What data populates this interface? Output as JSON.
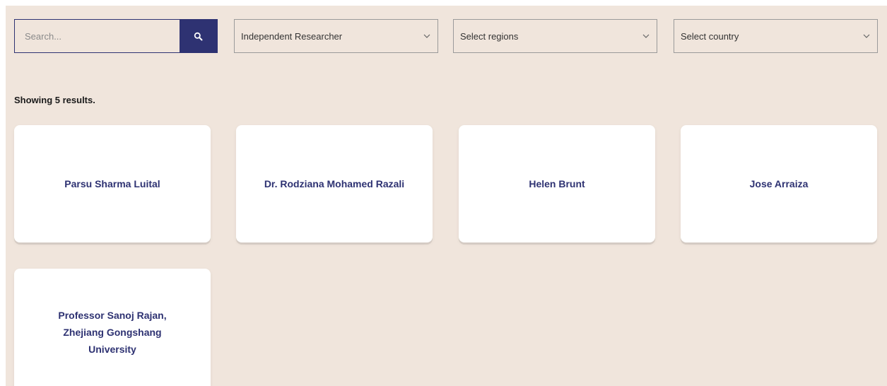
{
  "search": {
    "placeholder": "Search..."
  },
  "filters": {
    "type": {
      "selected": "Independent Researcher"
    },
    "regions": {
      "selected": "Select regions"
    },
    "country": {
      "selected": "Select country"
    }
  },
  "results": {
    "summary": "Showing 5 results.",
    "items": [
      {
        "name": "Parsu Sharma Luital"
      },
      {
        "name": "Dr. Rodziana Mohamed Razali"
      },
      {
        "name": "Helen Brunt"
      },
      {
        "name": "Jose Arraiza"
      },
      {
        "name": "Professor Sanoj Rajan, Zhejiang Gongshang University"
      }
    ]
  },
  "colors": {
    "page_background": "#f0e5dc",
    "accent": "#2e3272",
    "card_background": "#ffffff"
  },
  "icons": {
    "search": "search-icon",
    "dropdown": "chevron-down-icon"
  }
}
